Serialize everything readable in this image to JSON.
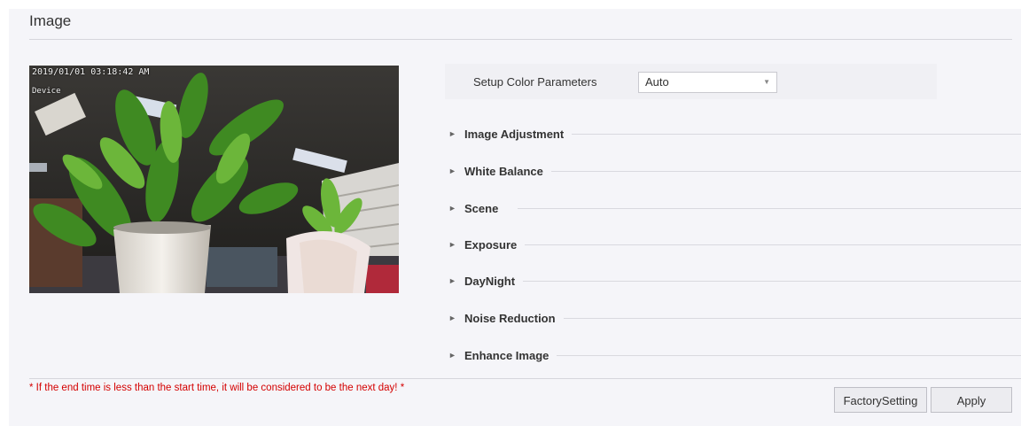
{
  "page": {
    "title": "Image"
  },
  "preview": {
    "timestamp": "2019/01/01 03:18:42 AM",
    "device_name": "Device"
  },
  "color_params": {
    "label": "Setup Color Parameters",
    "selected": "Auto"
  },
  "sections": [
    {
      "label": "Image Adjustment"
    },
    {
      "label": "White Balance"
    },
    {
      "label": "Scene"
    },
    {
      "label": "Exposure"
    },
    {
      "label": "DayNight"
    },
    {
      "label": "Noise Reduction"
    },
    {
      "label": "Enhance Image"
    }
  ],
  "notice": "* If the end time is less than the start time, it will be considered to be the next day! *",
  "buttons": {
    "factory": "FactorySetting",
    "apply": "Apply"
  },
  "colors": {
    "notice": "#d40000",
    "panel_bg": "#f5f5f9"
  }
}
